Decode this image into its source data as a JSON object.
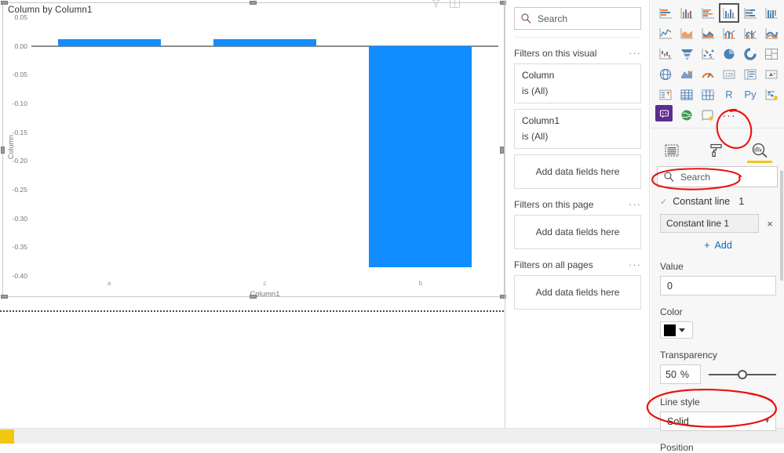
{
  "visual": {
    "title": "Column by Column1",
    "header_icons": [
      "filter-icon",
      "focus-mode-icon"
    ]
  },
  "chart_data": {
    "type": "bar",
    "title": "Column by Column1",
    "xlabel": "Column1",
    "ylabel": "Column",
    "categories": [
      "a",
      "c",
      "b"
    ],
    "values": [
      0.012,
      0.012,
      -0.385
    ],
    "series": [
      {
        "name": "Column",
        "values": [
          0.012,
          0.012,
          -0.385
        ]
      }
    ],
    "ylim": [
      -0.4,
      0.05
    ],
    "yticks": [
      "0.05",
      "0.00",
      "-0.05",
      "-0.10",
      "-0.15",
      "-0.20",
      "-0.25",
      "-0.30",
      "-0.35",
      "-0.40"
    ],
    "ytick_values": [
      0.05,
      0.0,
      -0.05,
      -0.1,
      -0.15,
      -0.2,
      -0.25,
      -0.3,
      -0.35,
      -0.4
    ],
    "grid": false,
    "legend": "none",
    "bar_color": "#118DFF",
    "zero_line_color": "#8c8c8c",
    "constant_line_value": 0
  },
  "filter_pane": {
    "search_placeholder": "Search",
    "sections": [
      {
        "title": "Filters on this visual",
        "more_label": "···",
        "filters": [
          {
            "field": "Column",
            "condition": "is (All)"
          },
          {
            "field": "Column1",
            "condition": "is (All)"
          }
        ],
        "dropzone": "Add data fields here"
      },
      {
        "title": "Filters on this page",
        "more_label": "···",
        "filters": [],
        "dropzone": "Add data fields here"
      },
      {
        "title": "Filters on all pages",
        "more_label": "···",
        "filters": [],
        "dropzone": "Add data fields here"
      }
    ]
  },
  "viz_pane": {
    "gallery": [
      {
        "name": "stacked-bar-chart-icon",
        "selected": false
      },
      {
        "name": "stacked-column-chart-icon",
        "selected": false
      },
      {
        "name": "clustered-bar-chart-icon",
        "selected": false
      },
      {
        "name": "clustered-column-chart-icon",
        "selected": true
      },
      {
        "name": "hundred-percent-stacked-bar-chart-icon",
        "selected": false
      },
      {
        "name": "hundred-percent-stacked-column-chart-icon",
        "selected": false
      },
      {
        "name": "line-chart-icon",
        "selected": false
      },
      {
        "name": "area-chart-icon",
        "selected": false
      },
      {
        "name": "stacked-area-chart-icon",
        "selected": false
      },
      {
        "name": "line-and-stacked-column-chart-icon",
        "selected": false
      },
      {
        "name": "line-and-clustered-column-chart-icon",
        "selected": false
      },
      {
        "name": "ribbon-chart-icon",
        "selected": false
      },
      {
        "name": "waterfall-chart-icon",
        "selected": false
      },
      {
        "name": "funnel-chart-icon",
        "selected": false
      },
      {
        "name": "scatter-chart-icon",
        "selected": false
      },
      {
        "name": "pie-chart-icon",
        "selected": false
      },
      {
        "name": "donut-chart-icon",
        "selected": false
      },
      {
        "name": "treemap-icon",
        "selected": false
      },
      {
        "name": "map-icon",
        "selected": false
      },
      {
        "name": "filled-map-icon",
        "selected": false
      },
      {
        "name": "gauge-icon",
        "selected": false
      },
      {
        "name": "card-icon",
        "selected": false
      },
      {
        "name": "multi-row-card-icon",
        "selected": false
      },
      {
        "name": "kpi-icon",
        "selected": false
      },
      {
        "name": "slicer-icon",
        "selected": false
      },
      {
        "name": "table-icon",
        "selected": false
      },
      {
        "name": "matrix-icon",
        "selected": false
      },
      {
        "name": "r-script-visual-icon",
        "selected": false,
        "glyph": "R"
      },
      {
        "name": "python-visual-icon",
        "selected": false,
        "glyph": "Py"
      },
      {
        "name": "key-influencers-icon",
        "selected": false
      },
      {
        "name": "qna-visual-icon",
        "selected": false
      },
      {
        "name": "arcgis-map-icon",
        "selected": false
      },
      {
        "name": "paginated-report-icon",
        "selected": false
      },
      {
        "name": "more-visuals-icon",
        "selected": false,
        "glyph": "···"
      }
    ],
    "tabs": [
      {
        "name": "fields-pane-tab",
        "label": "Fields",
        "active": false
      },
      {
        "name": "format-pane-tab",
        "label": "Format",
        "active": false
      },
      {
        "name": "analytics-pane-tab",
        "label": "Analytics",
        "active": true
      }
    ],
    "search_placeholder": "Search",
    "analytics": {
      "group": {
        "label": "Constant line",
        "count": "1",
        "expanded": true
      },
      "item_name": "Constant line 1",
      "close_label": "×",
      "add_label": "Add",
      "add_plus": "+",
      "value_label": "Value",
      "value": "0",
      "color_label": "Color",
      "color": "#000000",
      "transparency_label": "Transparency",
      "transparency_value": "50",
      "transparency_unit": "%",
      "transparency_percent": 50,
      "line_style_label": "Line style",
      "line_style_value": "Solid",
      "position_label": "Position"
    }
  },
  "annotations": {
    "color": "#e8130f",
    "marks": [
      "circle-analytics-tab",
      "circle-constant-line-group",
      "circle-line-style-dropdown"
    ]
  }
}
